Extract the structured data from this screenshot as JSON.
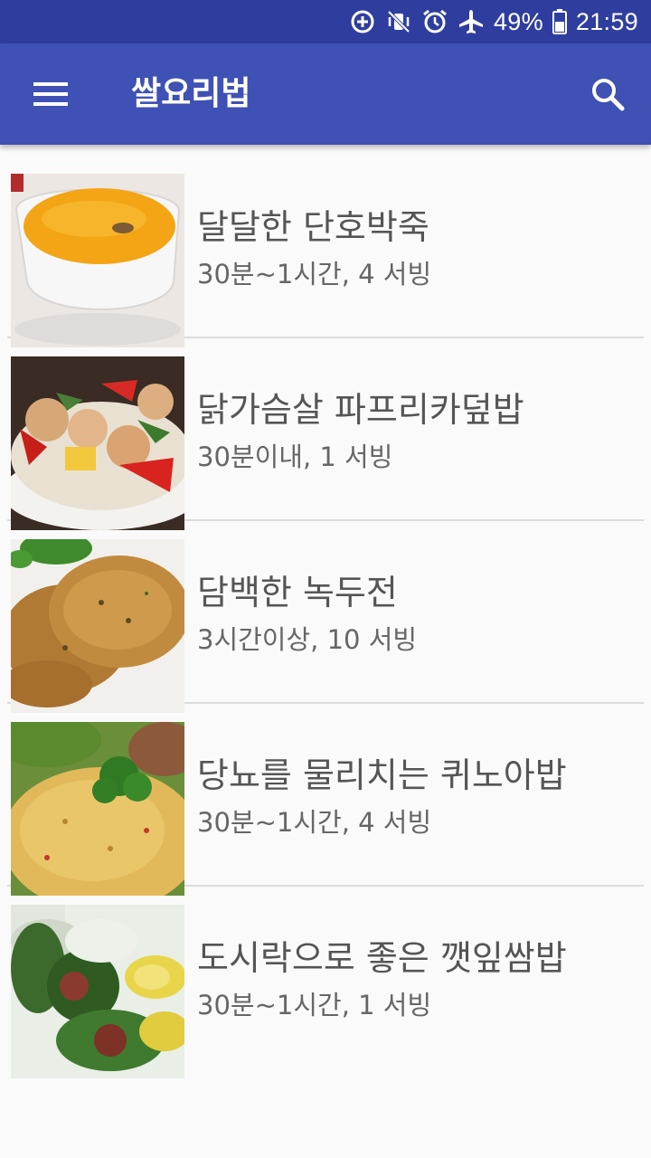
{
  "status_bar": {
    "battery": "49%",
    "time": "21:59",
    "icons": [
      "data-saver-icon",
      "vibrate-mute-icon",
      "alarm-icon",
      "airplane-icon",
      "battery-icon"
    ]
  },
  "app_bar": {
    "title": "쌀요리법",
    "menu_icon": "hamburger-menu-icon",
    "search_icon": "search-icon"
  },
  "recipes": [
    {
      "title": "달달한 단호박죽",
      "meta": "30분~1시간, 4 서빙",
      "image": "pumpkin-porridge-photo"
    },
    {
      "title": "닭가슴살 파프리카덮밥",
      "meta": "30분이내, 1 서빙",
      "image": "chicken-paprika-rice-bowl-photo"
    },
    {
      "title": "담백한 녹두전",
      "meta": "3시간이상, 10 서빙",
      "image": "mung-bean-pancake-photo"
    },
    {
      "title": "당뇨를 물리치는 퀴노아밥",
      "meta": "30분~1시간, 4 서빙",
      "image": "quinoa-rice-photo"
    },
    {
      "title": "도시락으로 좋은 깻잎쌈밥",
      "meta": "30분~1시간, 1 서빙",
      "image": "perilla-leaf-rice-wrap-photo"
    }
  ],
  "colors": {
    "status_bar": "#2f3e9e",
    "app_bar": "#3f51b5",
    "background": "#fafafa",
    "divider": "#dcdcdc"
  }
}
